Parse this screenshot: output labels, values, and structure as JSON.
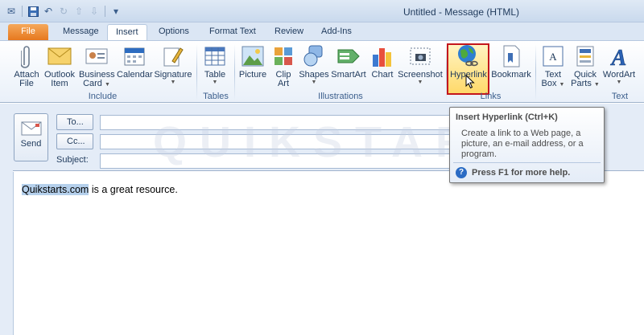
{
  "window": {
    "title": "Untitled - Message (HTML)"
  },
  "tabs": [
    "File",
    "Message",
    "Insert",
    "Options",
    "Format Text",
    "Review",
    "Add-Ins"
  ],
  "ribbon": {
    "groups": {
      "include": "Include",
      "tables": "Tables",
      "illustrations": "Illustrations",
      "links": "Links",
      "text": "Text"
    },
    "buttons": {
      "attach_file": [
        "Attach",
        "File"
      ],
      "outlook_item": [
        "Outlook",
        "Item"
      ],
      "business_card": [
        "Business",
        "Card"
      ],
      "calendar": "Calendar",
      "signature": "Signature",
      "table": "Table",
      "picture": "Picture",
      "clip_art": [
        "Clip",
        "Art"
      ],
      "shapes": "Shapes",
      "smartart": "SmartArt",
      "chart": "Chart",
      "screenshot": "Screenshot",
      "hyperlink": "Hyperlink",
      "bookmark": "Bookmark",
      "text_box": [
        "Text",
        "Box"
      ],
      "quick_parts": [
        "Quick",
        "Parts"
      ],
      "wordart": "WordArt"
    }
  },
  "message": {
    "send_label": "Send",
    "to_label": "To...",
    "cc_label": "Cc...",
    "subject_label": "Subject:",
    "body_selected": "Quikstarts.com",
    "body_rest": " is a great resource."
  },
  "tooltip": {
    "title": "Insert Hyperlink (Ctrl+K)",
    "description": "Create a link to a Web page, a picture, an e-mail address, or a program.",
    "help": "Press F1 for more help."
  },
  "watermark": "QUIKSTARTS",
  "colors": {
    "file_tab": "#e6781e",
    "highlight_border": "#c4161c",
    "selection": "#b5d0ec"
  }
}
